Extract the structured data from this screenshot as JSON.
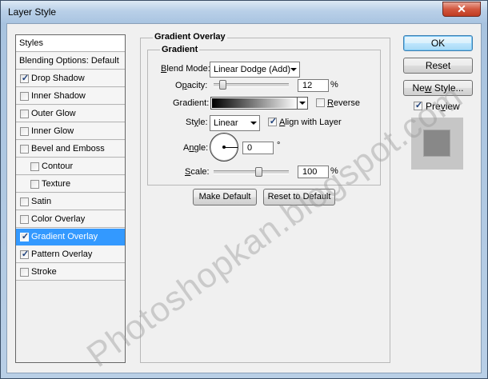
{
  "window": {
    "title": "Layer Style"
  },
  "sidebar": {
    "header": "Styles",
    "items": [
      {
        "label": "Blending Options: Default",
        "checkbox": false,
        "checked": false,
        "selected": false
      },
      {
        "label": "Drop Shadow",
        "checkbox": true,
        "checked": true,
        "selected": false,
        "indent": false
      },
      {
        "label": "Inner Shadow",
        "checkbox": true,
        "checked": false,
        "selected": false,
        "indent": false
      },
      {
        "label": "Outer Glow",
        "checkbox": true,
        "checked": false,
        "selected": false,
        "indent": false
      },
      {
        "label": "Inner Glow",
        "checkbox": true,
        "checked": false,
        "selected": false,
        "indent": false
      },
      {
        "label": "Bevel and Emboss",
        "checkbox": true,
        "checked": false,
        "selected": false,
        "indent": false
      },
      {
        "label": "Contour",
        "checkbox": true,
        "checked": false,
        "selected": false,
        "indent": true
      },
      {
        "label": "Texture",
        "checkbox": true,
        "checked": false,
        "selected": false,
        "indent": true
      },
      {
        "label": "Satin",
        "checkbox": true,
        "checked": false,
        "selected": false,
        "indent": false
      },
      {
        "label": "Color Overlay",
        "checkbox": true,
        "checked": false,
        "selected": false,
        "indent": false
      },
      {
        "label": "Gradient Overlay",
        "checkbox": true,
        "checked": true,
        "selected": true,
        "indent": false
      },
      {
        "label": "Pattern Overlay",
        "checkbox": true,
        "checked": true,
        "selected": false,
        "indent": false
      },
      {
        "label": "Stroke",
        "checkbox": true,
        "checked": false,
        "selected": false,
        "indent": false
      }
    ]
  },
  "panel": {
    "section_title": "Gradient Overlay",
    "group_title": "Gradient",
    "blend_mode": {
      "label_pre": "",
      "label_u": "B",
      "label_post": "lend Mode:",
      "value": "Linear Dodge (Add)"
    },
    "opacity": {
      "label_pre": "O",
      "label_u": "p",
      "label_post": "acity:",
      "value": "12",
      "unit": "%",
      "level_percent": 12
    },
    "gradient": {
      "label": "Gradient:",
      "reverse_pre": "",
      "reverse_u": "R",
      "reverse_post": "everse",
      "reverse_checked": false
    },
    "style": {
      "label_pre": "St",
      "label_u": "y",
      "label_post": "le:",
      "value": "Linear",
      "align_pre": "",
      "align_u": "A",
      "align_post": "lign with Layer",
      "align_checked": true
    },
    "angle": {
      "label_pre": "A",
      "label_u": "n",
      "label_post": "gle:",
      "value": "0",
      "unit": "°"
    },
    "scale": {
      "label_pre": "",
      "label_u": "S",
      "label_post": "cale:",
      "value": "100",
      "unit": "%",
      "level_percent": 100
    },
    "make_default": "Make Default",
    "reset_default": "Reset to Default"
  },
  "actions": {
    "ok": "OK",
    "reset": "Reset",
    "new_style_pre": "Ne",
    "new_style_u": "w",
    "new_style_post": " Style...",
    "preview_pre": "Pre",
    "preview_u": "v",
    "preview_post": "iew",
    "preview_checked": true
  },
  "watermark": "Photoshopkan.blogspot.com",
  "colors": {
    "selection": "#3399ff",
    "close_button": "#c8432a",
    "title_bar": "#b9d0e8"
  },
  "icons": {
    "close": "close-icon",
    "checkmark": "checkmark-icon",
    "dropdown": "chevron-down-icon"
  }
}
